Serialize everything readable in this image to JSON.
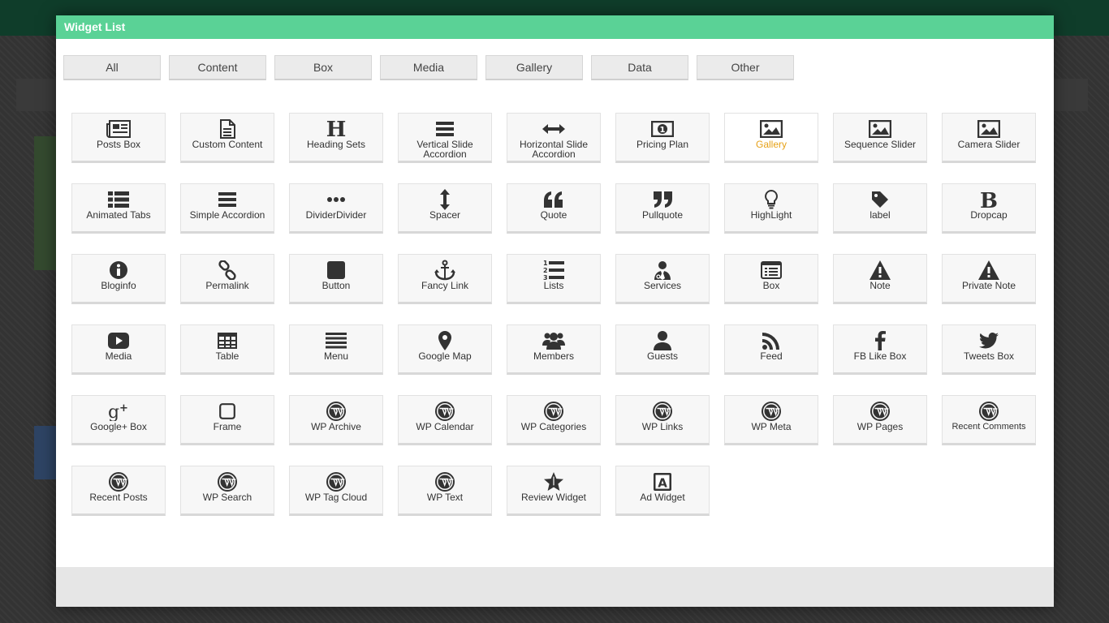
{
  "modal": {
    "title": "Widget List"
  },
  "filters": [
    {
      "label": "All"
    },
    {
      "label": "Content"
    },
    {
      "label": "Box"
    },
    {
      "label": "Media"
    },
    {
      "label": "Gallery"
    },
    {
      "label": "Data"
    },
    {
      "label": "Other"
    }
  ],
  "widgets": [
    {
      "label": "Posts Box",
      "icon": "newspaper-icon"
    },
    {
      "label": "Custom Content",
      "icon": "document-icon"
    },
    {
      "label": "Heading Sets",
      "icon": "heading-icon"
    },
    {
      "label": "Vertical Slide Accordion",
      "icon": "bars-icon"
    },
    {
      "label": "Horizontal Slide Accordion",
      "icon": "horizontal-arrows-icon"
    },
    {
      "label": "Pricing Plan",
      "icon": "money-icon"
    },
    {
      "label": "Gallery",
      "icon": "image-icon",
      "active": true
    },
    {
      "label": "Sequence Slider",
      "icon": "image-icon"
    },
    {
      "label": "Camera Slider",
      "icon": "image-icon"
    },
    {
      "label": "Animated Tabs",
      "icon": "list-icon"
    },
    {
      "label": "Simple Accordion",
      "icon": "bars-icon"
    },
    {
      "label": "DividerDivider",
      "icon": "ellipsis-icon"
    },
    {
      "label": "Spacer",
      "icon": "vertical-arrows-icon"
    },
    {
      "label": "Quote",
      "icon": "quote-left-icon"
    },
    {
      "label": "Pullquote",
      "icon": "quote-right-icon"
    },
    {
      "label": "HighLight",
      "icon": "lightbulb-icon"
    },
    {
      "label": "label",
      "icon": "tag-icon"
    },
    {
      "label": "Dropcap",
      "icon": "bold-icon"
    },
    {
      "label": "Bloginfo",
      "icon": "info-icon"
    },
    {
      "label": "Permalink",
      "icon": "link-icon"
    },
    {
      "label": "Button",
      "icon": "square-icon"
    },
    {
      "label": "Fancy Link",
      "icon": "anchor-icon"
    },
    {
      "label": "Lists",
      "icon": "numbered-list-icon"
    },
    {
      "label": "Services",
      "icon": "user-tie-icon"
    },
    {
      "label": "Box",
      "icon": "list-alt-icon"
    },
    {
      "label": "Note",
      "icon": "warning-icon"
    },
    {
      "label": "Private Note",
      "icon": "warning-icon"
    },
    {
      "label": "Media",
      "icon": "play-icon"
    },
    {
      "label": "Table",
      "icon": "table-icon"
    },
    {
      "label": "Menu",
      "icon": "menu-icon"
    },
    {
      "label": "Google Map",
      "icon": "map-marker-icon"
    },
    {
      "label": "Members",
      "icon": "users-icon"
    },
    {
      "label": "Guests",
      "icon": "user-icon"
    },
    {
      "label": "Feed",
      "icon": "rss-icon"
    },
    {
      "label": "FB Like Box",
      "icon": "facebook-icon"
    },
    {
      "label": "Tweets Box",
      "icon": "twitter-icon"
    },
    {
      "label": "Google+ Box",
      "icon": "google-plus-icon"
    },
    {
      "label": "Frame",
      "icon": "square-outline-icon"
    },
    {
      "label": "WP Archive",
      "icon": "wordpress-icon"
    },
    {
      "label": "WP Calendar",
      "icon": "wordpress-icon"
    },
    {
      "label": "WP Categories",
      "icon": "wordpress-icon"
    },
    {
      "label": "WP Links",
      "icon": "wordpress-icon"
    },
    {
      "label": "WP Meta",
      "icon": "wordpress-icon"
    },
    {
      "label": "WP Pages",
      "icon": "wordpress-icon"
    },
    {
      "label": "Recent Comments",
      "icon": "wordpress-icon",
      "small": true
    },
    {
      "label": "Recent Posts",
      "icon": "wordpress-icon"
    },
    {
      "label": "WP Search",
      "icon": "wordpress-icon"
    },
    {
      "label": "WP Tag Cloud",
      "icon": "wordpress-icon"
    },
    {
      "label": "WP Text",
      "icon": "wordpress-icon"
    },
    {
      "label": "Review Widget",
      "icon": "star-icon"
    },
    {
      "label": "Ad Widget",
      "icon": "ad-icon"
    }
  ]
}
